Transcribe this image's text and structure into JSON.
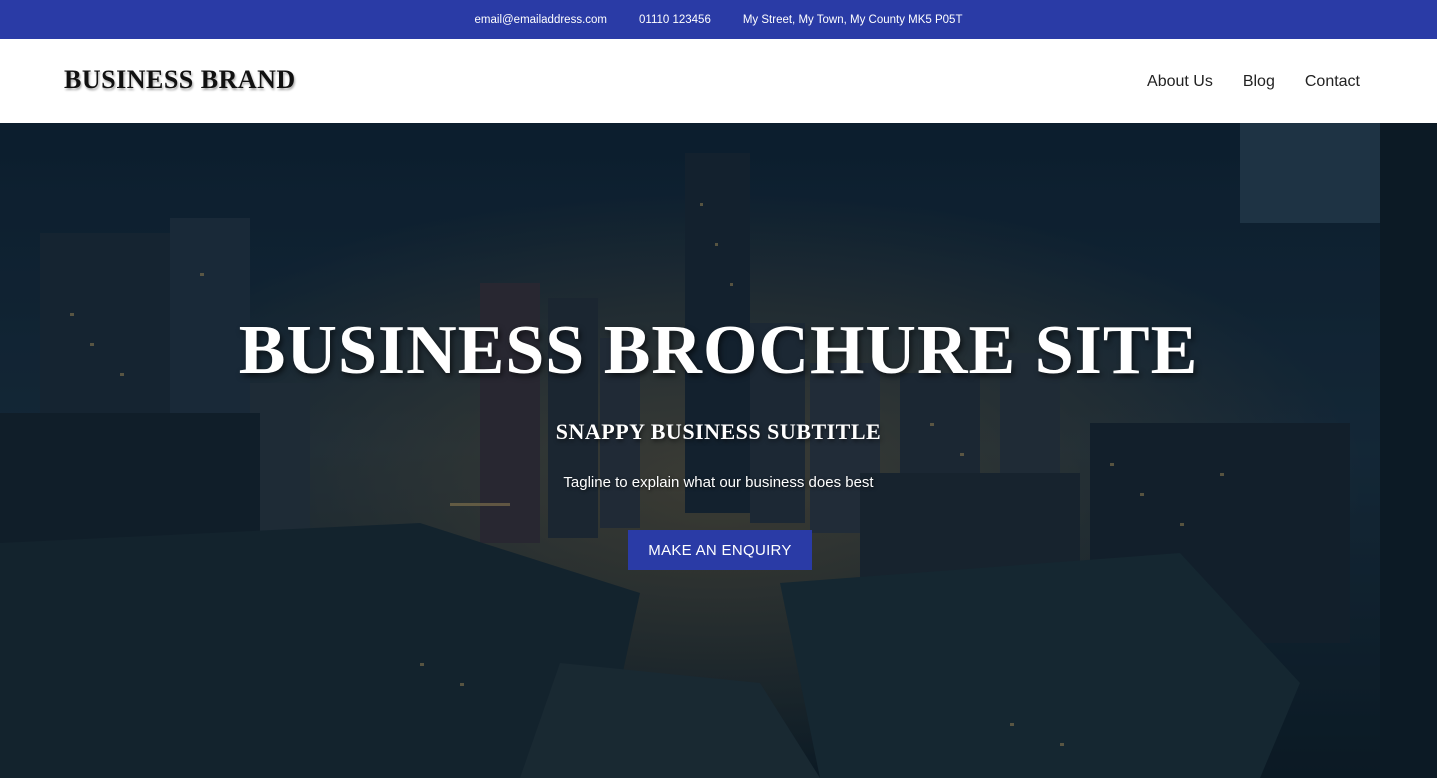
{
  "topbar": {
    "email": "email@emailaddress.com",
    "phone": "01110 123456",
    "address": "My Street, My Town, My County MK5 P05T",
    "background_color": "#2a3ba6"
  },
  "header": {
    "brand": "BUSINESS BRAND",
    "nav": [
      {
        "label": "About Us"
      },
      {
        "label": "Blog"
      },
      {
        "label": "Contact"
      }
    ]
  },
  "hero": {
    "title": "BUSINESS BROCHURE SITE",
    "subtitle": "SNAPPY BUSINESS SUBTITLE",
    "tagline": "Tagline to explain what our business does best",
    "cta_label": "MAKE AN ENQUIRY",
    "cta_color": "#2a3ba6",
    "background_image": "night city skyline aerial view"
  }
}
